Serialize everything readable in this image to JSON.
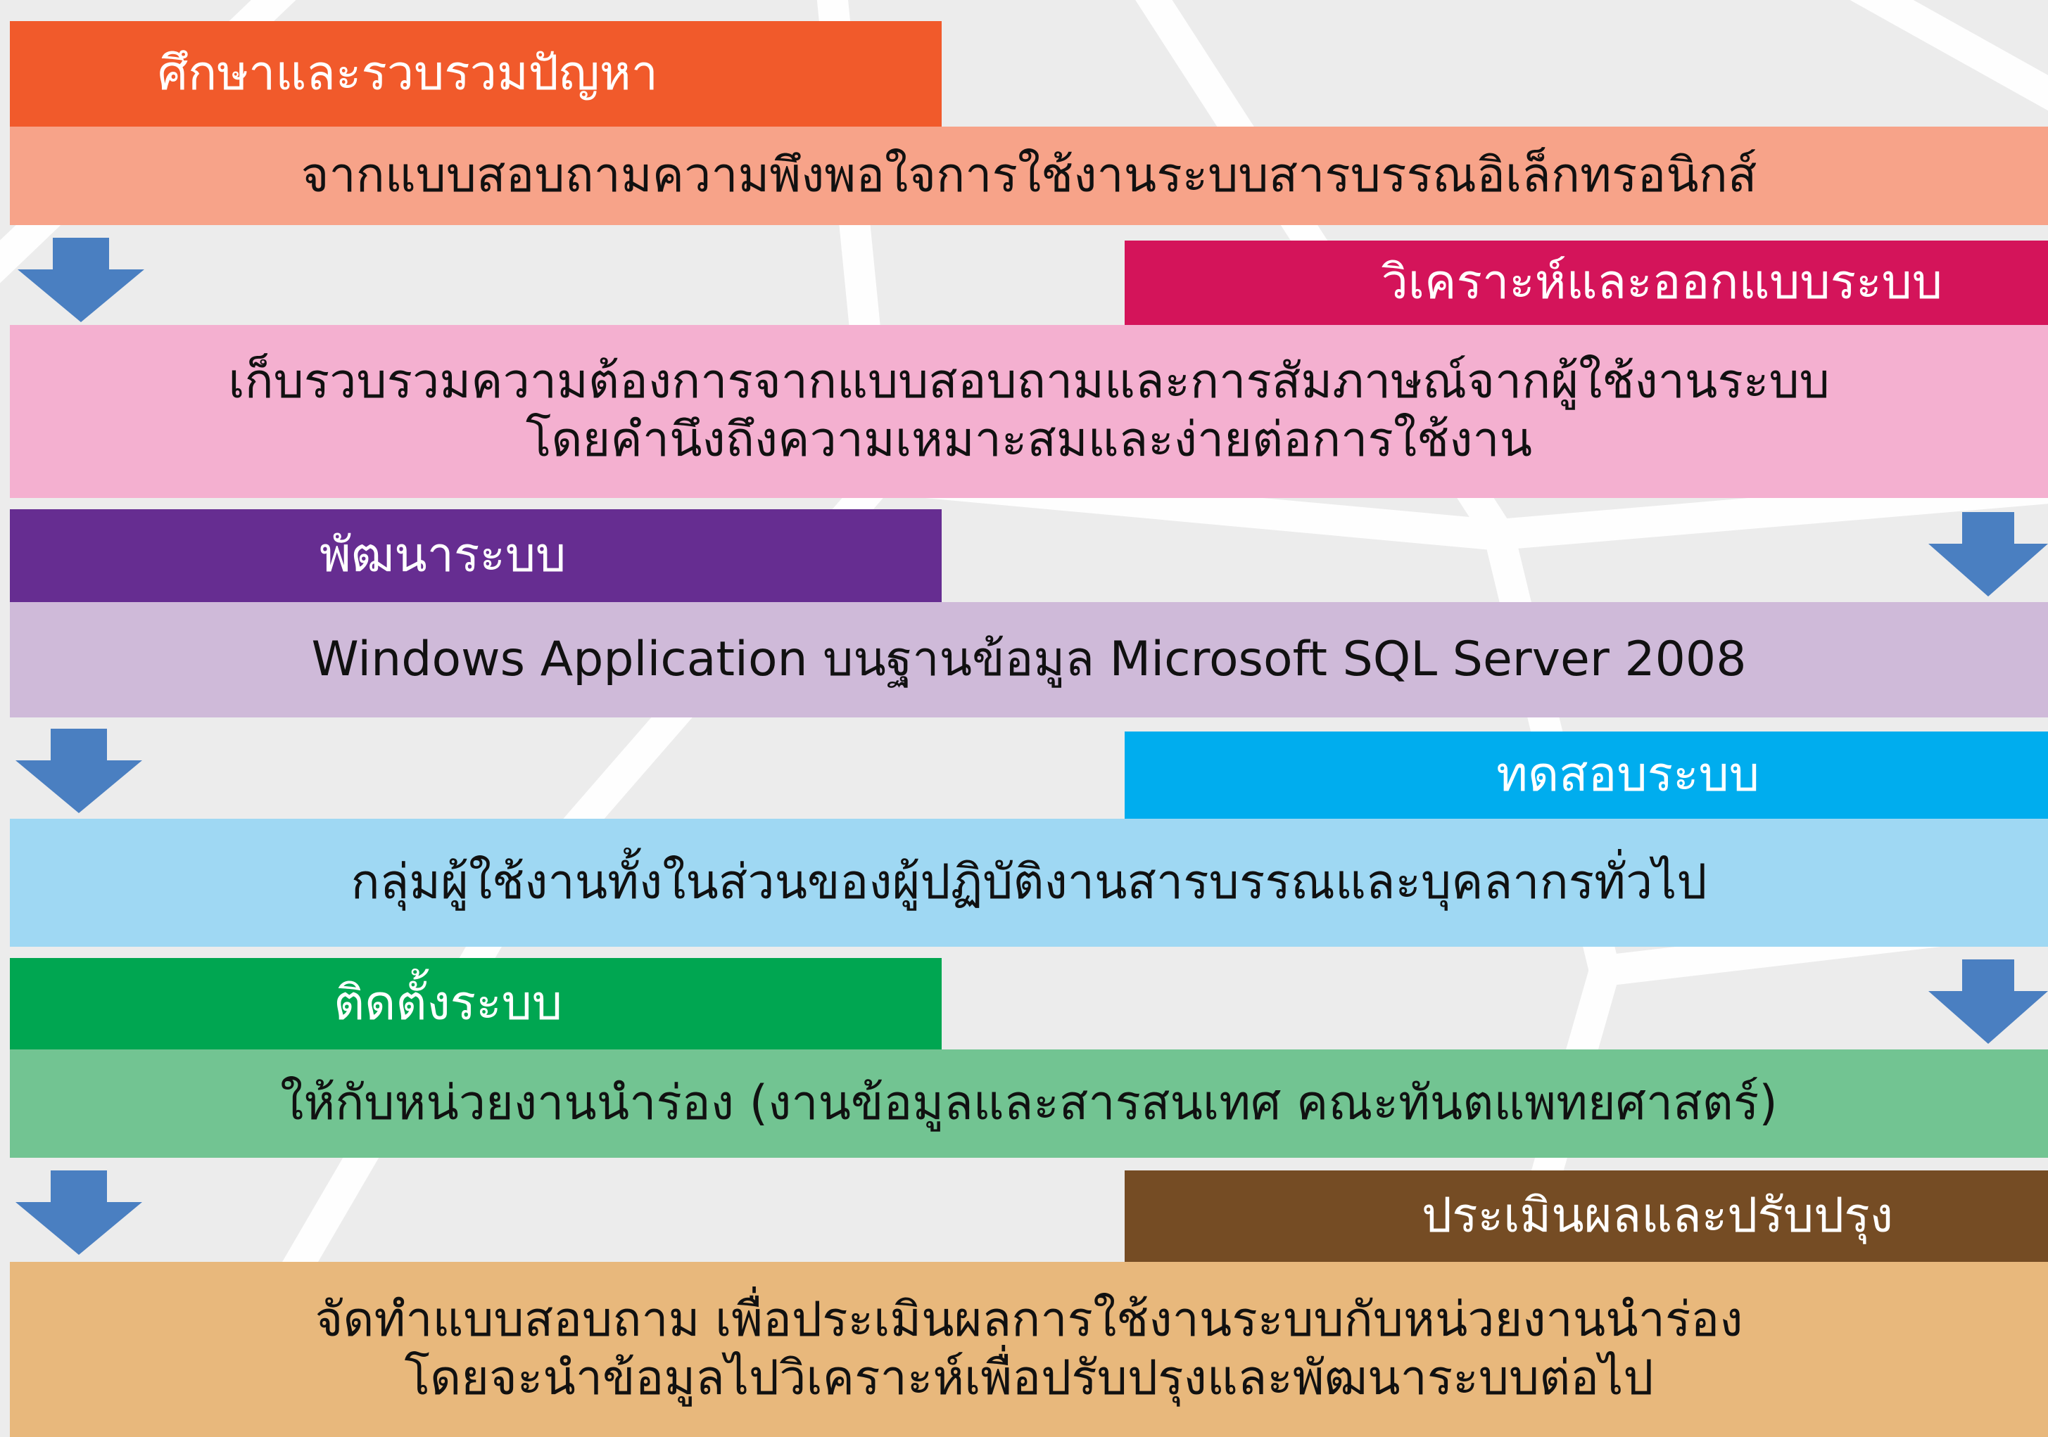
{
  "colors": {
    "background": "#ececec",
    "arrow": "#4a7fc1"
  },
  "steps": [
    {
      "title": "ศึกษาและรวบรวมปัญหา",
      "description": [
        "จากแบบสอบถามความพึงพอใจการใช้งานระบบสารบรรณอิเล็กทรอนิกส์"
      ],
      "title_color": "#f15a2b",
      "description_color": "#f7a389"
    },
    {
      "title": "วิเคราะห์และออกแบบระบบ",
      "description": [
        "เก็บรวบรวมความต้องการจากแบบสอบถามและการสัมภาษณ์จากผู้ใช้งานระบบ",
        "โดยคำนึงถึงความเหมาะสมและง่ายต่อการใช้งาน"
      ],
      "title_color": "#d4145a",
      "description_color": "#f4b0d0"
    },
    {
      "title": "พัฒนาระบบ",
      "description": [
        "Windows Application บนฐานข้อมูล Microsoft SQL Server 2008"
      ],
      "title_color": "#662d91",
      "description_color": "#cfbad9"
    },
    {
      "title": "ทดสอบระบบ",
      "description": [
        "กลุ่มผู้ใช้งานทั้งในส่วนของผู้ปฏิบัติงานสารบรรณและบุคลากรทั่วไป"
      ],
      "title_color": "#00adee",
      "description_color": "#9fd8f3"
    },
    {
      "title": "ติดตั้งระบบ",
      "description": [
        "ให้กับหน่วยงานนำร่อง (งานข้อมูลและสารสนเทศ คณะทันตแพทยศาสตร์)"
      ],
      "title_color": "#00a651",
      "description_color": "#72c492"
    },
    {
      "title": "ประเมินผลและปรับปรุง",
      "description": [
        "จัดทำแบบสอบถาม เพื่อประเมินผลการใช้งานระบบกับหน่วยงานนำร่อง",
        "โดยจะนำข้อมูลไปวิเคราะห์เพื่อปรับปรุงและพัฒนาระบบต่อไป"
      ],
      "title_color": "#754c24",
      "description_color": "#e8b87c"
    }
  ]
}
